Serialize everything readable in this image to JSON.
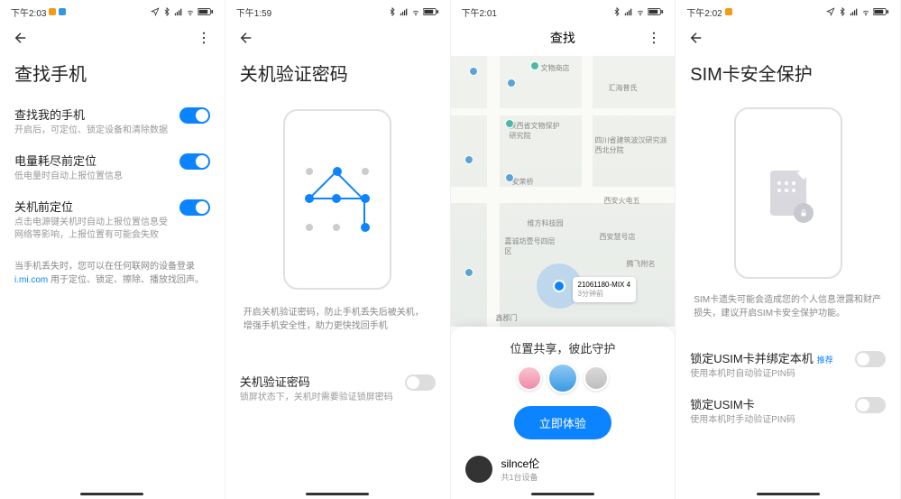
{
  "screen1": {
    "status_time": "下午2:03",
    "title": "查找手机",
    "items": [
      {
        "label": "查找我的手机",
        "desc": "开启后，可定位、锁定设备和清除数据",
        "on": true
      },
      {
        "label": "电量耗尽前定位",
        "desc": "低电量时自动上报位置信息",
        "on": true
      },
      {
        "label": "关机前定位",
        "desc": "点击电源键关机时自动上报位置信息受网络等影响，上报位置有可能会失败",
        "on": true
      }
    ],
    "footer_pre": "当手机丢失时，您可以在任何联网的设备登录 ",
    "footer_link": "i.mi.com",
    "footer_post": " 用于定位、锁定、擦除、播放找回声。"
  },
  "screen2": {
    "status_time": "下午1:59",
    "title": "关机验证密码",
    "illu_desc": "开启关机验证密码，防止手机丢失后被关机，增强手机安全性，助力更快找回手机",
    "item_label": "关机验证密码",
    "item_desc": "锁屏状态下，关机时需要验证锁屏密码"
  },
  "screen3": {
    "status_time": "下午2:01",
    "nav_title": "查找",
    "callout_line1": "21061180-MIX 4",
    "callout_line2": "3分钟前",
    "share_title": "位置共享，彼此守护",
    "cta": "立即体验",
    "user_name": "silnce伦",
    "user_sub": "共1台设备",
    "map_labels": {
      "l1": "文物商店",
      "l2": "汇海普氏",
      "l3": "陕西省文物保护研究院",
      "l4": "四川省建筑波汉研究派西北分院",
      "l5": "安荣桥",
      "l6": "西安火电五",
      "l7": "维方科技园",
      "l8": "嘉诚坊壹号四层区",
      "l9": "西安慧号店",
      "l10": "腾飞附名",
      "l11": "鑫郡门"
    }
  },
  "screen4": {
    "status_time": "下午2:02",
    "title": "SIM卡安全保护",
    "illu_desc": "SIM卡遗失可能会造成您的个人信息泄露和财产损失，建议开启SIM卡安全保护功能。",
    "items": [
      {
        "label": "锁定USIM卡并绑定本机",
        "badge": "推荐",
        "desc": "使用本机时自动验证PIN码"
      },
      {
        "label": "锁定USIM卡",
        "desc": "使用本机时手动验证PIN码"
      }
    ]
  }
}
